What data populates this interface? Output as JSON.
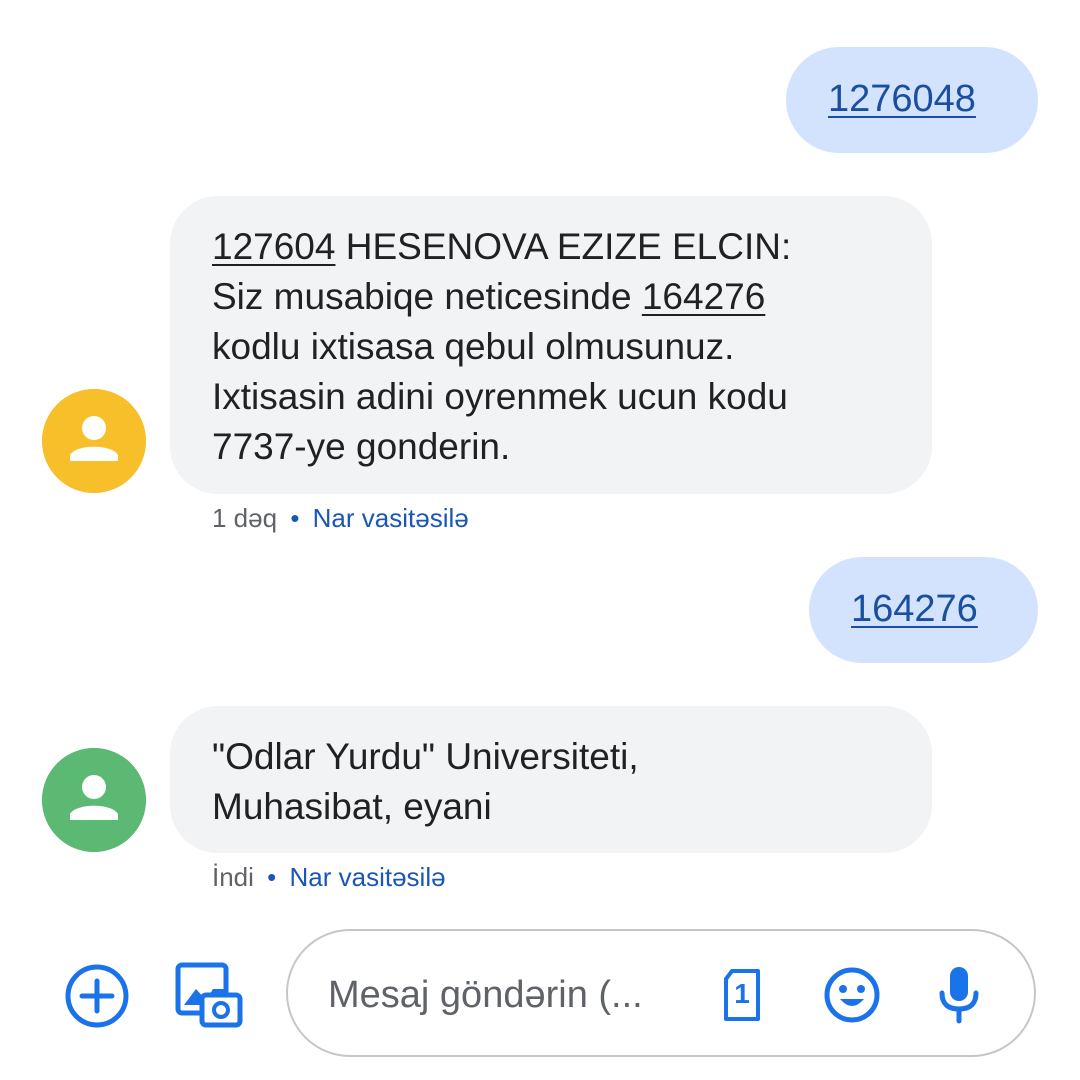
{
  "conversation": {
    "messages": [
      {
        "direction": "outgoing",
        "text": "1276048"
      },
      {
        "direction": "incoming",
        "avatar_color": "#f7c02a",
        "lines": [
          {
            "code": "127604",
            "rest": " HESENOVA EZIZE ELCIN:"
          },
          {
            "prefix": "Siz musabiqe neticesinde ",
            "code": "164276"
          },
          {
            "text": "kodlu ixtisasa qebul olmusunuz."
          },
          {
            "text": "Ixtisasin adini oyrenmek ucun kodu"
          },
          {
            "text": "7737-ye gonderin."
          }
        ],
        "time": "1 dəq",
        "separator": "•",
        "via": "Nar vasitəsilə"
      },
      {
        "direction": "outgoing",
        "text": "164276"
      },
      {
        "direction": "incoming",
        "avatar_color": "#5bb974",
        "lines": [
          {
            "text": "\"Odlar Yurdu\" Universiteti,"
          },
          {
            "text": "Muhasibat, eyani"
          }
        ],
        "time": "İndi",
        "separator": "•",
        "via": "Nar vasitəsilə"
      }
    ]
  },
  "composer": {
    "placeholder": "Mesaj göndərin (...",
    "sim_slot": "1",
    "icons": [
      "add-icon",
      "gallery-camera-icon",
      "sim-icon",
      "emoji-icon",
      "microphone-icon"
    ],
    "accent_color": "#1a73e8"
  }
}
